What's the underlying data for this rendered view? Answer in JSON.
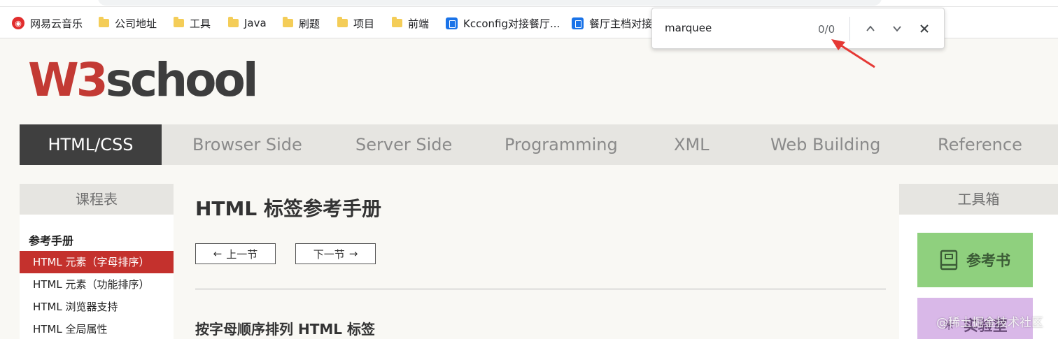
{
  "bookmarks": [
    {
      "label": "网易云音乐",
      "icon": "netease-music-icon"
    },
    {
      "label": "公司地址",
      "icon": "folder-icon"
    },
    {
      "label": "工具",
      "icon": "folder-icon"
    },
    {
      "label": "Java",
      "icon": "folder-icon"
    },
    {
      "label": "刷题",
      "icon": "folder-icon"
    },
    {
      "label": "项目",
      "icon": "folder-icon"
    },
    {
      "label": "前端",
      "icon": "folder-icon"
    },
    {
      "label": "Kcconfig对接餐厅...",
      "icon": "doc-icon"
    },
    {
      "label": "餐厅主档对接",
      "icon": "doc-icon"
    }
  ],
  "find": {
    "query": "marquee",
    "count": "0/0"
  },
  "logo": {
    "w3": "W3",
    "school": "school"
  },
  "nav": {
    "items": [
      "HTML/CSS",
      "Browser Side",
      "Server Side",
      "Programming",
      "XML",
      "Web Building",
      "Reference"
    ],
    "active": "HTML/CSS"
  },
  "left_sidebar": {
    "title": "课程表",
    "group": "参考手册",
    "items": [
      "HTML 元素（字母排序）",
      "HTML 元素（功能排序）",
      "HTML 浏览器支持",
      "HTML 全局属性"
    ]
  },
  "main": {
    "title": "HTML 标签参考手册",
    "prev": "上一节",
    "next": "下一节",
    "subtitle": "按字母顺序排列 HTML 标签"
  },
  "right_sidebar": {
    "title": "工具箱",
    "tools": [
      "参考书",
      "实验室"
    ]
  },
  "watermark": "@稀土掘金技术社区",
  "colors": {
    "accent_red": "#c4312d",
    "nav_active": "#3f3f3f",
    "tool_green": "#8fd07e",
    "tool_purple": "#d9b8e8"
  }
}
